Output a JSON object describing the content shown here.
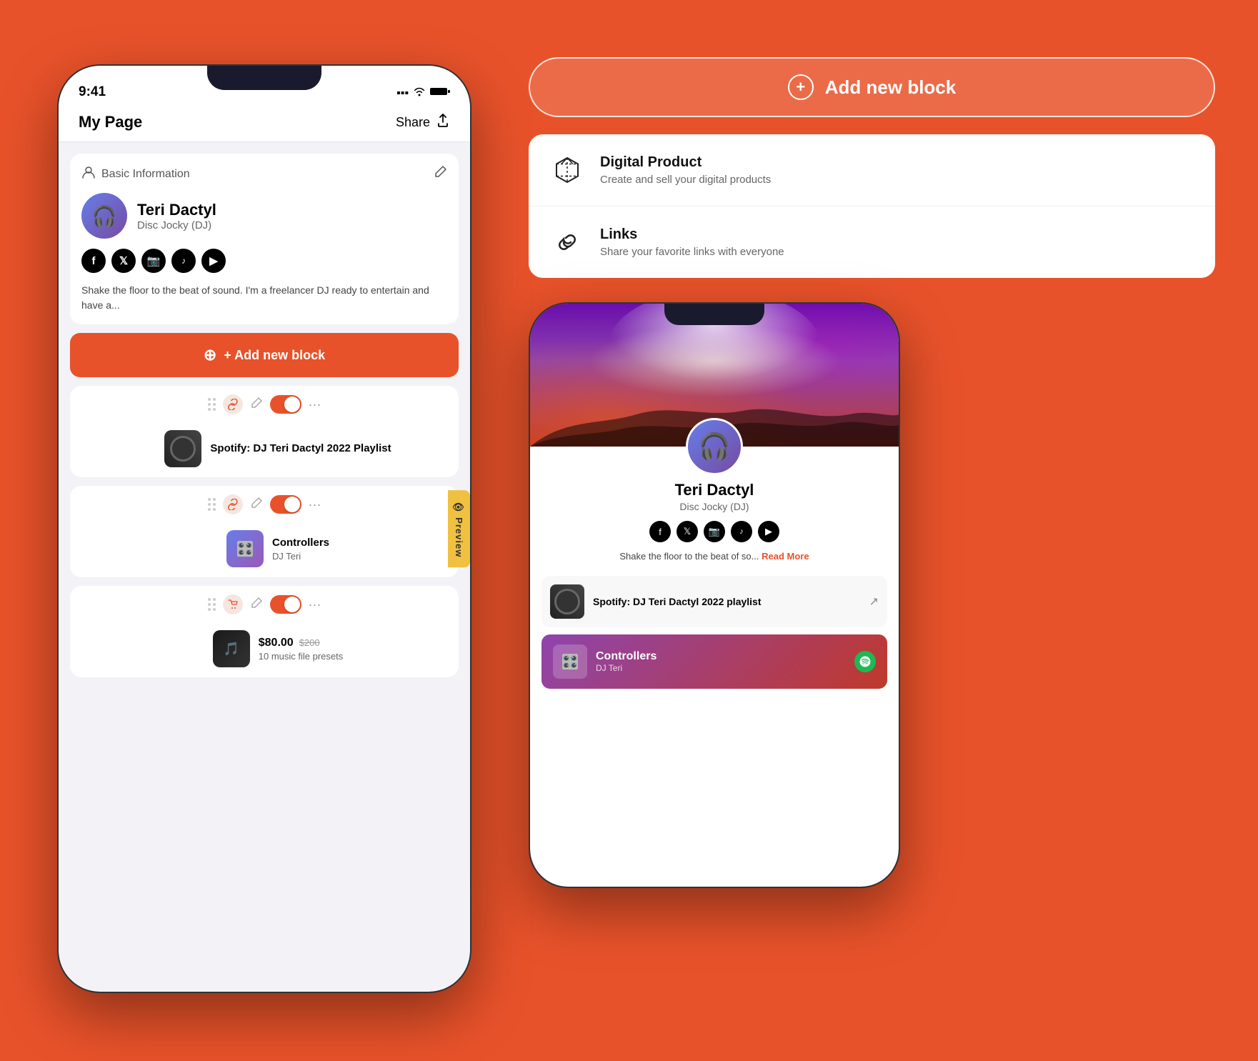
{
  "background": "#E8522A",
  "phone_left": {
    "status_time": "9:41",
    "signal_icon": "●●●",
    "wifi_icon": "wifi",
    "battery_icon": "battery",
    "nav_title": "My Page",
    "nav_share": "Share",
    "basic_info_label": "Basic Information",
    "profile_name": "Teri Dactyl",
    "profile_title": "Disc Jocky (DJ)",
    "bio": "Shake the floor to the beat of sound. I'm a freelancer DJ ready to entertain and have a...",
    "add_block_label": "+ Add new block",
    "preview_tab": "Preview",
    "blocks": [
      {
        "type": "link",
        "title": "Spotify: DJ Teri Dactyl 2022 Playlist",
        "enabled": true
      },
      {
        "type": "link",
        "title": "Controllers",
        "subtitle": "DJ Teri",
        "enabled": true
      },
      {
        "type": "product",
        "price": "$80.00",
        "original_price": "$200",
        "subtitle": "10 music file presets",
        "enabled": true
      }
    ]
  },
  "add_block_top_label": "Add new block",
  "block_options": [
    {
      "icon": "box-icon",
      "title": "Digital Product",
      "desc": "Create and sell your digital products"
    },
    {
      "icon": "link-icon",
      "title": "Links",
      "desc": "Share your favorite links with everyone"
    }
  ],
  "phone_right": {
    "profile_name": "Teri Dactyl",
    "profile_title": "Disc Jocky (DJ)",
    "bio": "Shake the floor to the beat of so...",
    "read_more": "Read More",
    "spotify_link_title": "Spotify: DJ Teri Dactyl 2022 playlist",
    "controllers_title": "Controllers",
    "controllers_sub": "DJ Teri"
  }
}
